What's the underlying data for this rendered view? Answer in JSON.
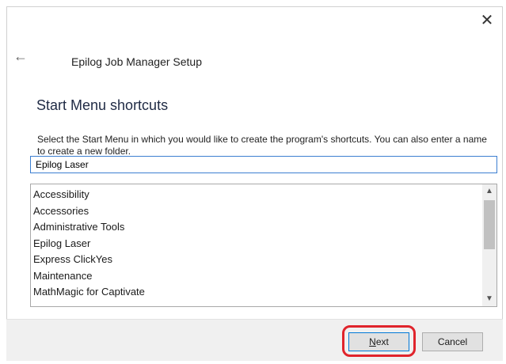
{
  "window": {
    "close_glyph": "✕",
    "back_glyph": "←",
    "setup_title": "Epilog Job Manager Setup"
  },
  "section": {
    "title": "Start Menu shortcuts",
    "description": "Select the Start Menu in which you would like to create the program's shortcuts. You can also enter a name to create a new folder."
  },
  "folder_input": {
    "value": "Epilog Laser"
  },
  "folder_list": {
    "items": [
      "Accessibility",
      "Accessories",
      "Administrative Tools",
      "Epilog Laser",
      "Express ClickYes",
      "Maintenance",
      "MathMagic for Captivate"
    ]
  },
  "buttons": {
    "next_label_mnemonic": "N",
    "next_label_rest": "ext",
    "cancel_label": "Cancel"
  },
  "colors": {
    "highlight": "#e0242c",
    "focus_border": "#3c7fd1"
  },
  "icons": {
    "close": "close-icon",
    "back": "back-arrow-icon",
    "scroll_up": "chevron-up-icon",
    "scroll_down": "chevron-down-icon"
  }
}
